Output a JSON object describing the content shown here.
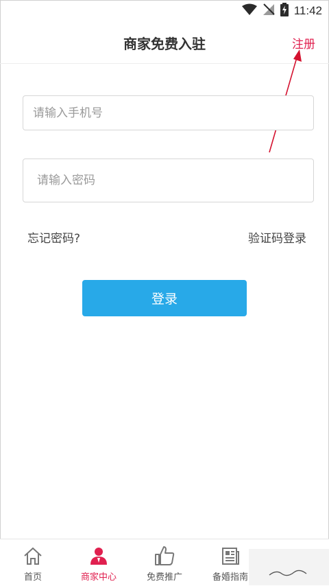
{
  "status_bar": {
    "time": "11:42"
  },
  "header": {
    "title": "商家免费入驻",
    "register_label": "注册"
  },
  "form": {
    "phone_placeholder": "请输入手机号",
    "password_placeholder": "请输入密码",
    "forgot_label": "忘记密码?",
    "sms_login_label": "验证码登录",
    "login_label": "登录"
  },
  "bottom_nav": {
    "items": [
      {
        "label": "首页",
        "icon": "home-icon"
      },
      {
        "label": "商家中心",
        "icon": "merchant-icon",
        "active": true
      },
      {
        "label": "免费推广",
        "icon": "thumbs-up-icon"
      },
      {
        "label": "备婚指南",
        "icon": "guide-icon"
      }
    ]
  },
  "colors": {
    "accent": "#e0204f",
    "button": "#28a9e8"
  }
}
